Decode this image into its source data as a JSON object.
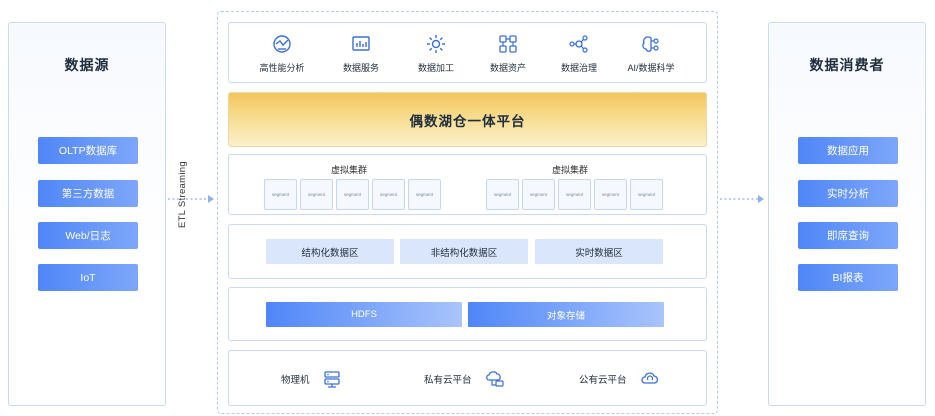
{
  "colors": {
    "accent": "#4f86f7",
    "border": "#c9d9f3",
    "core_gold": "#f3c65c",
    "zone_fill": "#dae6fc"
  },
  "left_panel": {
    "title": "数据源",
    "items": [
      {
        "label": "OLTP数据库"
      },
      {
        "label": "第三方数据"
      },
      {
        "label": "Web/日志"
      },
      {
        "label": "IoT"
      }
    ]
  },
  "etl_label": "ETL Streaming",
  "platform": {
    "services": [
      {
        "label": "高性能分析",
        "icon": "analytics-icon"
      },
      {
        "label": "数据服务",
        "icon": "chart-board-icon"
      },
      {
        "label": "数据加工",
        "icon": "gear-icon"
      },
      {
        "label": "数据资产",
        "icon": "assets-icon"
      },
      {
        "label": "数据治理",
        "icon": "network-icon"
      },
      {
        "label": "AI/数据科学",
        "icon": "ai-brain-icon"
      }
    ],
    "core_title": "偶数湖仓一体平台",
    "clusters": [
      {
        "title": "虚拟集群",
        "segments": [
          "segment",
          "segment",
          "segment",
          "segment",
          "segment"
        ]
      },
      {
        "title": "虚拟集群",
        "segments": [
          "segment",
          "segment",
          "segment",
          "segment",
          "segment"
        ]
      }
    ],
    "zones": [
      {
        "label": "结构化数据区"
      },
      {
        "label": "非结构化数据区"
      },
      {
        "label": "实时数据区"
      }
    ],
    "storage": [
      {
        "label": "HDFS"
      },
      {
        "label": "对象存储"
      }
    ],
    "infra": [
      {
        "label": "物理机",
        "icon": "server-icon"
      },
      {
        "label": "私有云平台",
        "icon": "private-cloud-icon"
      },
      {
        "label": "公有云平台",
        "icon": "public-cloud-icon"
      }
    ]
  },
  "right_panel": {
    "title": "数据消费者",
    "items": [
      {
        "label": "数据应用"
      },
      {
        "label": "实时分析"
      },
      {
        "label": "即席查询"
      },
      {
        "label": "BI报表"
      }
    ]
  }
}
